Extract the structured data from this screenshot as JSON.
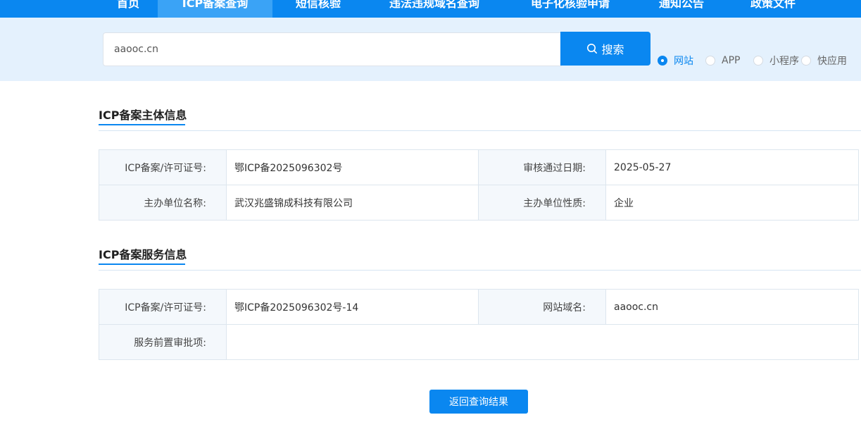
{
  "nav": {
    "items": [
      {
        "label": "首页"
      },
      {
        "label": "ICP备案查询"
      },
      {
        "label": "短信核验"
      },
      {
        "label": "违法违规域名查询"
      },
      {
        "label": "电子化核验申请"
      },
      {
        "label": "通知公告"
      },
      {
        "label": "政策文件"
      }
    ],
    "active_index": 1
  },
  "search": {
    "value": "aaooc.cn",
    "button_label": "搜索",
    "button_icon": "search-icon",
    "options": [
      {
        "label": "网站",
        "checked": true
      },
      {
        "label": "APP",
        "checked": false
      },
      {
        "label": "小程序",
        "checked": false
      },
      {
        "label": "快应用",
        "checked": false
      }
    ]
  },
  "subject_section": {
    "title": "ICP备案主体信息",
    "rows": [
      {
        "label1": "ICP备案/许可证号:",
        "value1": "鄂ICP备2025096302号",
        "label2": "审核通过日期:",
        "value2": "2025-05-27"
      },
      {
        "label1": "主办单位名称:",
        "value1": "武汉兆盛锦成科技有限公司",
        "label2": "主办单位性质:",
        "value2": "企业"
      }
    ]
  },
  "service_section": {
    "title": "ICP备案服务信息",
    "row1": {
      "label1": "ICP备案/许可证号:",
      "value1": "鄂ICP备2025096302号-14",
      "label2": "网站域名:",
      "value2": "aaooc.cn"
    },
    "row2": {
      "label": "服务前置审批项:",
      "value": ""
    }
  },
  "back_button_label": "返回查询结果",
  "colors": {
    "primary": "#0a87f0",
    "nav_active": "#3aa3f6",
    "search_band": "#e4f1fd",
    "label_bg": "#f4f8fc"
  }
}
